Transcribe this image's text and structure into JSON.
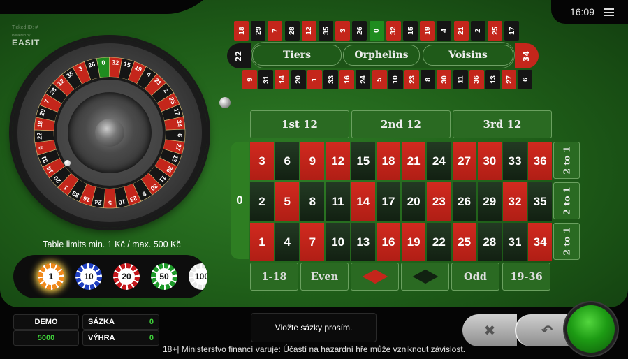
{
  "header": {
    "time": "16:09",
    "ticket_label": "Ticked ID: #",
    "powered_by": "Powered by",
    "logo": "EASIT"
  },
  "wheel": {
    "numbers": [
      "0",
      "32",
      "15",
      "19",
      "4",
      "21",
      "2",
      "25",
      "17",
      "34",
      "6",
      "27",
      "13",
      "36",
      "11",
      "30",
      "8",
      "23",
      "10",
      "5",
      "24",
      "16",
      "33",
      "1",
      "20",
      "14",
      "31",
      "9",
      "22",
      "18",
      "29",
      "7",
      "28",
      "12",
      "35",
      "3",
      "26"
    ]
  },
  "limits": "Table limits min. 1 Kč / max. 500 Kč",
  "chips": [
    {
      "label": "1",
      "color": "#f08a1c",
      "selected": true
    },
    {
      "label": "10",
      "color": "#1f3fbf"
    },
    {
      "label": "20",
      "color": "#c4171c"
    },
    {
      "label": "50",
      "color": "#1e9a2a"
    },
    {
      "label": "100",
      "color": "#e9e9e9"
    }
  ],
  "racetrack": {
    "top": [
      "18",
      "29",
      "7",
      "28",
      "12",
      "35",
      "3",
      "26",
      "0",
      "32",
      "15",
      "19",
      "4",
      "21",
      "2",
      "25",
      "17"
    ],
    "bottom": [
      "9",
      "31",
      "14",
      "20",
      "1",
      "33",
      "16",
      "24",
      "5",
      "10",
      "23",
      "8",
      "30",
      "11",
      "36",
      "13",
      "27",
      "6"
    ],
    "left_end": "22",
    "right_end": "34",
    "sections": [
      "Tiers",
      "Orphelins",
      "Voisins"
    ]
  },
  "board": {
    "zero": "0",
    "dozens": [
      "1st  12",
      "2nd  12",
      "3rd  12"
    ],
    "rows": [
      [
        "3",
        "6",
        "9",
        "12",
        "15",
        "18",
        "21",
        "24",
        "27",
        "30",
        "33",
        "36"
      ],
      [
        "2",
        "5",
        "8",
        "11",
        "14",
        "17",
        "20",
        "23",
        "26",
        "29",
        "32",
        "35"
      ],
      [
        "1",
        "4",
        "7",
        "10",
        "13",
        "16",
        "19",
        "22",
        "25",
        "28",
        "31",
        "34"
      ]
    ],
    "red": [
      "1",
      "3",
      "5",
      "7",
      "9",
      "12",
      "14",
      "16",
      "18",
      "19",
      "21",
      "23",
      "25",
      "27",
      "30",
      "32",
      "34",
      "36"
    ],
    "columns": [
      "2 to 1",
      "2 to 1",
      "2 to 1"
    ],
    "outside": [
      "1-18",
      "Even",
      "red",
      "black",
      "Odd",
      "19-36"
    ]
  },
  "bottom": {
    "mode": "DEMO",
    "balance": "5000",
    "bet_label": "SÁZKA",
    "bet_value": "0",
    "win_label": "VÝHRA",
    "win_value": "0",
    "message": "Vložte sázky prosím.",
    "warning": "18+| Ministerstvo financí varuje: Účastí na hazardní hře může vzniknout závislost.",
    "clear_icon": "✖",
    "undo_icon": "↶"
  },
  "colors": {
    "red": "#c4261b",
    "black": "#151515",
    "green": "#1f8c1f"
  }
}
